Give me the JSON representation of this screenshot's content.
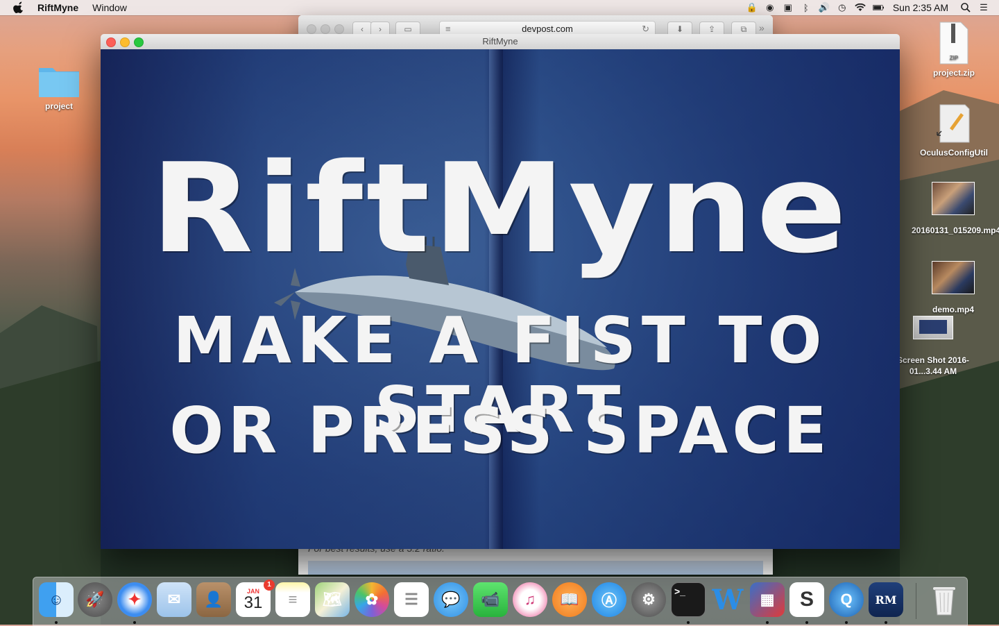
{
  "menubar": {
    "app_name": "RiftMyne",
    "menus": [
      "Window"
    ],
    "clock": "Sun 2:35 AM"
  },
  "desktop": {
    "icons": [
      {
        "label": "project",
        "icon": "folder-icon"
      },
      {
        "label": "project.zip",
        "icon": "zip-file-icon",
        "badge": "ZIP"
      },
      {
        "label": "OculusConfigUtil",
        "icon": "app-alias-icon"
      },
      {
        "label": "20160131_015209.mp4",
        "icon": "video-thumbnail-icon"
      },
      {
        "label": "demo.mp4",
        "icon": "video-thumbnail-icon"
      },
      {
        "label": "Screen Shot 2016-01...3.44 AM",
        "icon": "screenshot-thumbnail-icon"
      }
    ]
  },
  "safari": {
    "url": "devpost.com",
    "hint_text": "For best results, use a 3:2 ratio."
  },
  "game_window": {
    "title": "RiftMyne",
    "heading": "RiftMyne",
    "line1": "Make a fist to start",
    "line2": "or Press Space"
  },
  "calendar": {
    "month": "JAN",
    "day": "31",
    "badge": "1"
  },
  "dock": {
    "items": [
      "finder-icon",
      "launchpad-icon",
      "safari-icon",
      "mail-icon",
      "contacts-icon",
      "calendar-icon",
      "notes-icon",
      "maps-icon",
      "photos-icon",
      "reminders-icon",
      "messages-icon",
      "facetime-icon",
      "itunes-icon",
      "ibooks-icon",
      "app-store-icon",
      "system-preferences-icon",
      "terminal-icon",
      "word-icon",
      "virtualbox-icon",
      "slack-icon",
      "quicktime-icon",
      "riftmyne-icon",
      "trash-icon"
    ]
  }
}
